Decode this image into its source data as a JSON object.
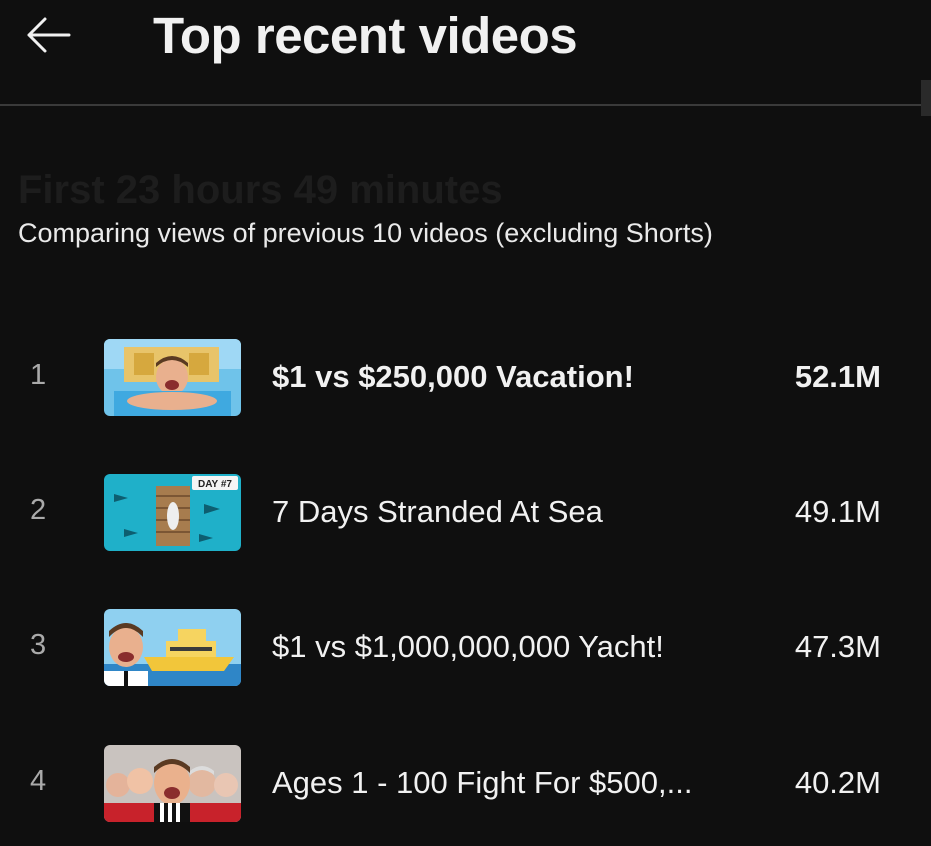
{
  "header": {
    "title": "Top recent videos",
    "back_icon": "arrow-left-icon"
  },
  "section": {
    "title": "First 23 hours 49 minutes",
    "subtitle": "Comparing views of previous 10 videos (excluding Shorts)"
  },
  "videos": [
    {
      "rank": "1",
      "title": "$1 vs $250,000 Vacation!",
      "views": "52.1M",
      "highlighted": true
    },
    {
      "rank": "2",
      "title": "7 Days Stranded At Sea",
      "views": "49.1M",
      "highlighted": false,
      "thumb_badge": "DAY #7"
    },
    {
      "rank": "3",
      "title": "$1 vs $1,000,000,000 Yacht!",
      "views": "47.3M",
      "highlighted": false
    },
    {
      "rank": "4",
      "title": "Ages 1 - 100 Fight For $500,...",
      "views": "40.2M",
      "highlighted": false
    }
  ],
  "colors": {
    "background": "#0f0f0f",
    "text": "#f1f1f1",
    "muted": "#aaaaaa",
    "divider": "#3a3a3a"
  }
}
